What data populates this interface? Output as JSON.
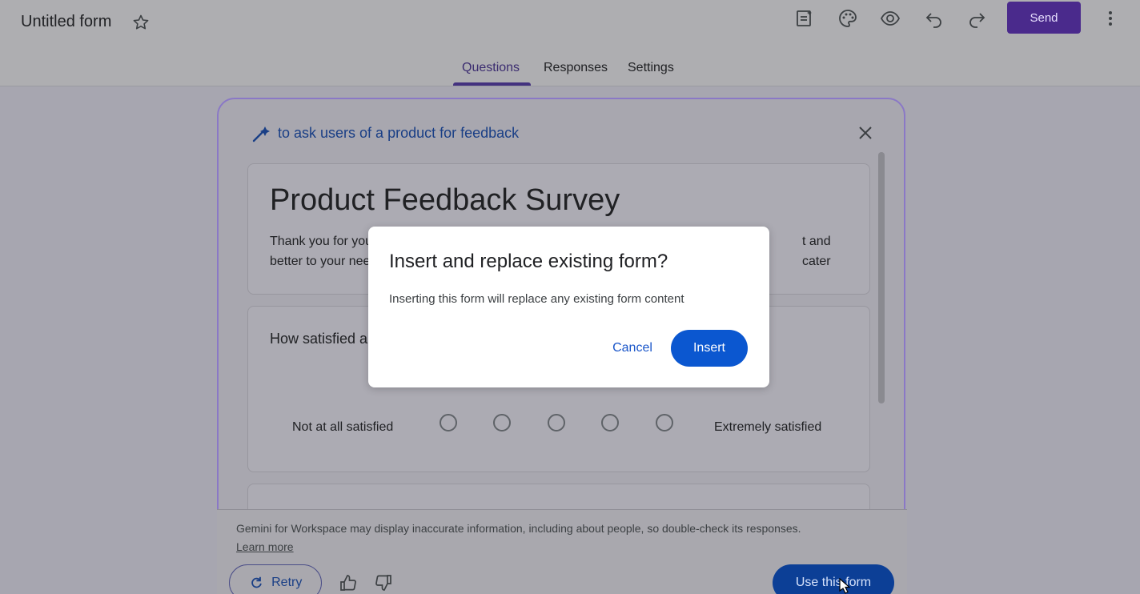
{
  "header": {
    "title": "Untitled form",
    "send_label": "Send",
    "icons": [
      "star-icon",
      "customize-theme-icon",
      "palette-icon",
      "preview-eye-icon",
      "undo-icon",
      "redo-icon",
      "more-vert-icon"
    ]
  },
  "tabs": [
    {
      "label": "Questions",
      "active": true
    },
    {
      "label": "Responses",
      "active": false
    },
    {
      "label": "Settings",
      "active": false
    }
  ],
  "panel": {
    "prompt": "to ask users of a product for feedback",
    "survey_title": "Product Feedback Survey",
    "description_left": "Thank you for you",
    "description_right": "t and cater",
    "description_line2": "better to your nee",
    "question_partial": "How satisfied a",
    "scale_left": "Not at all satisfied",
    "scale_right": "Extremely satisfied",
    "scale_options": 5
  },
  "footer": {
    "disclaimer": "Gemini for Workspace may display inaccurate information, including about people, so double-check its responses.",
    "learn_more": "Learn more",
    "retry_label": "Retry",
    "use_label": "Use this form"
  },
  "dialog": {
    "title": "Insert and replace existing form?",
    "body": "Inserting this form will replace any existing form content",
    "cancel_label": "Cancel",
    "insert_label": "Insert"
  },
  "colors": {
    "accent": "#4a2a8c",
    "primary_button": "#0b57d0",
    "link": "#1a3f86"
  }
}
